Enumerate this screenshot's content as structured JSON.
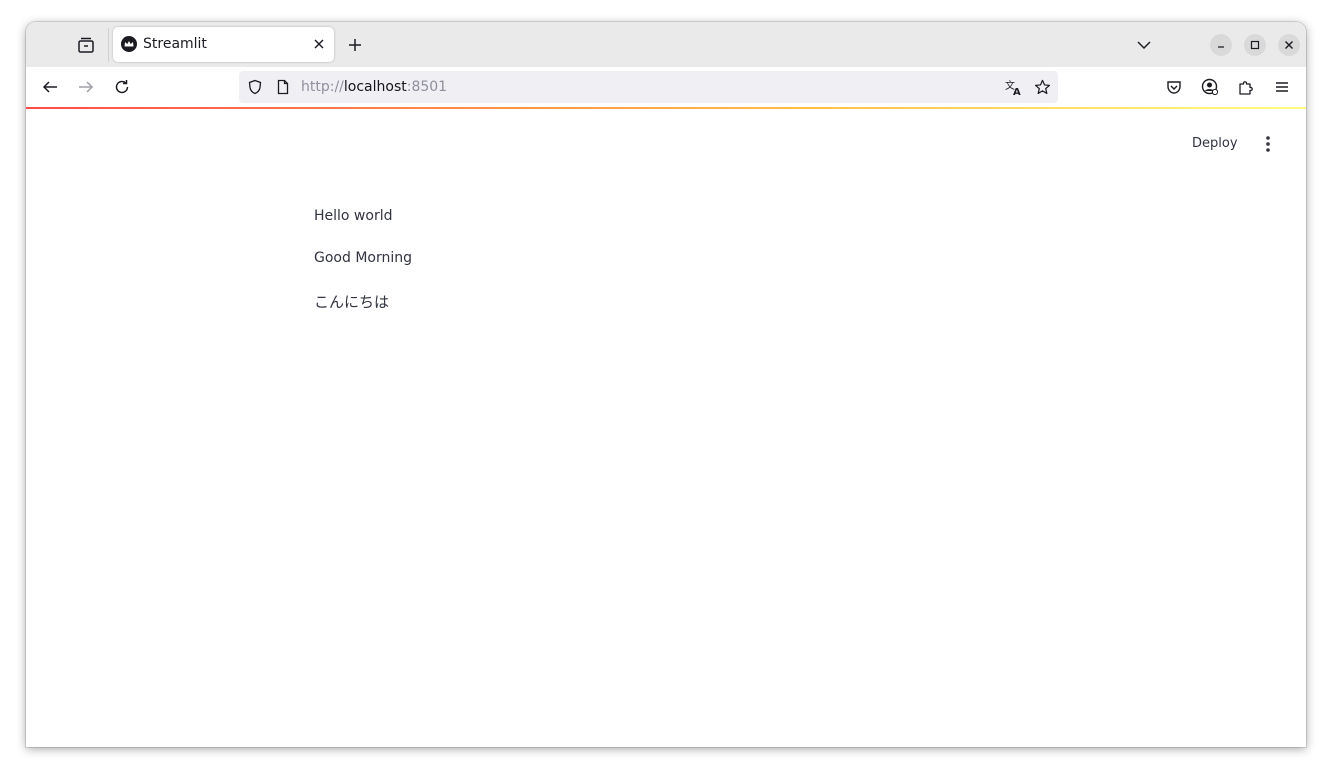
{
  "browser": {
    "tab": {
      "title": "Streamlit",
      "favicon": "streamlit-crown-icon"
    },
    "url": {
      "scheme": "http://",
      "host": "localhost",
      "port": ":8501"
    },
    "icons": {
      "tab_manager": "tab-manager-icon",
      "close_tab": "close-icon",
      "new_tab": "plus-icon",
      "list_tabs": "chevron-down-icon",
      "minimize": "minimize-icon",
      "maximize": "maximize-icon",
      "close_window": "close-icon",
      "back": "back-arrow-icon",
      "forward": "forward-arrow-icon",
      "reload": "reload-icon",
      "tracking_protection": "shield-icon",
      "page_info": "page-icon",
      "translate": "translate-icon",
      "bookmark": "star-icon",
      "pocket": "pocket-icon",
      "account": "account-icon",
      "extensions": "puzzle-icon",
      "menu": "hamburger-menu-icon"
    }
  },
  "app": {
    "header": {
      "deploy_label": "Deploy",
      "menu_icon": "kebab-menu-icon"
    },
    "lines": [
      "Hello world",
      "Good Morning",
      "こんにちは"
    ]
  },
  "colors": {
    "text": "#31333f",
    "tabstrip": "#eaeaea",
    "accent_gradient_start": "#ff4b4b",
    "accent_gradient_end": "#fffd80"
  }
}
